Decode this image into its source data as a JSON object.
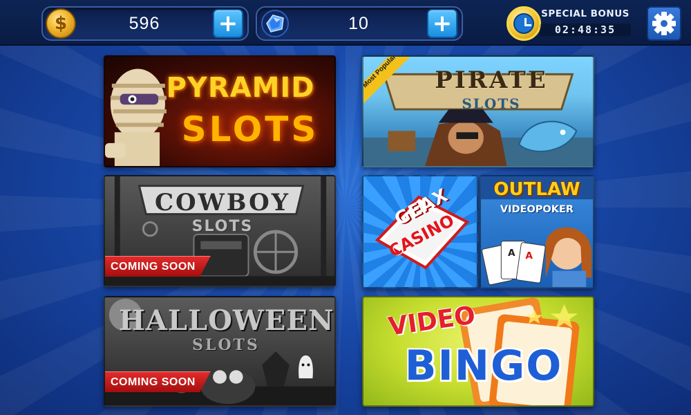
{
  "header": {
    "coins": {
      "amount": "596",
      "icon": "coin-icon",
      "add_label": "+"
    },
    "gems": {
      "amount": "10",
      "icon": "gem-icon",
      "add_label": "+"
    },
    "special_bonus": {
      "label": "SPECIAL BONUS",
      "timer": "02:48:35",
      "icon": "clock-icon"
    },
    "settings": {
      "icon": "gear-icon"
    }
  },
  "games": [
    {
      "id": "pyramid",
      "title": "PYRAMID",
      "subtitle": "SLOTS"
    },
    {
      "id": "pirate",
      "title": "PIRATE",
      "subtitle": "SLOTS",
      "ribbon": "Most Popular"
    },
    {
      "id": "cowboy",
      "title": "COWBOY",
      "subtitle": "SLOTS",
      "badge": "COMING SOON"
    },
    {
      "id": "geax",
      "title": "GEAX",
      "subtitle": "CASINO"
    },
    {
      "id": "outlaw",
      "title": "OUTLAW",
      "subtitle": "VIDEOPOKER"
    },
    {
      "id": "halloween",
      "title": "HALLOWEEN",
      "subtitle": "SLOTS",
      "badge": "COMING SOON"
    },
    {
      "id": "bingo",
      "title": "VIDEO",
      "subtitle": "BINGO"
    }
  ],
  "colors": {
    "background": "#1848a8",
    "topbar": "#0a1c44",
    "plus_button": "#1a8ee0",
    "coming_soon": "#d01c1c",
    "ribbon": "#f2c21a"
  }
}
